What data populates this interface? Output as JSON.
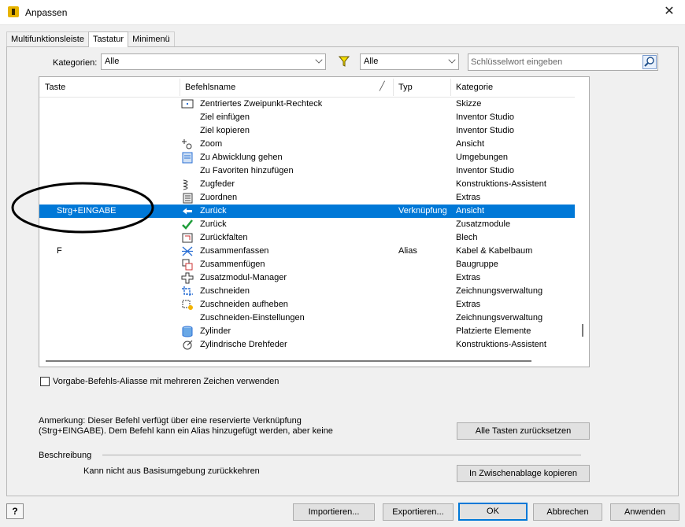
{
  "window": {
    "title": "Anpassen"
  },
  "tabs": [
    "Multifunktionsleiste",
    "Tastatur",
    "Minimenü"
  ],
  "filters": {
    "categories_label": "Kategorien:",
    "categories_value": "Alle",
    "filter_value": "Alle",
    "search_placeholder": "Schlüsselwort eingeben"
  },
  "columns": {
    "key": "Taste",
    "command": "Befehlsname",
    "type": "Typ",
    "category": "Kategorie"
  },
  "rows": [
    {
      "key": "",
      "command": "Zentriertes Zweipunkt-Rechteck",
      "type": "",
      "category": "Skizze",
      "icon": "rectangle-center-icon"
    },
    {
      "key": "",
      "command": "Ziel einfügen",
      "type": "",
      "category": "Inventor Studio",
      "icon": ""
    },
    {
      "key": "",
      "command": "Ziel kopieren",
      "type": "",
      "category": "Inventor Studio",
      "icon": ""
    },
    {
      "key": "",
      "command": "Zoom",
      "type": "",
      "category": "Ansicht",
      "icon": "zoom-icon"
    },
    {
      "key": "",
      "command": "Zu Abwicklung gehen",
      "type": "",
      "category": "Umgebungen",
      "icon": "flat-pattern-icon"
    },
    {
      "key": "",
      "command": "Zu Favoriten hinzufügen",
      "type": "",
      "category": "Inventor Studio",
      "icon": ""
    },
    {
      "key": "",
      "command": "Zugfeder",
      "type": "",
      "category": "Konstruktions-Assistent",
      "icon": "extension-spring-icon"
    },
    {
      "key": "",
      "command": "Zuordnen",
      "type": "",
      "category": "Extras",
      "icon": "assign-icon"
    },
    {
      "key": "Strg+EINGABE",
      "command": "Zurück",
      "type": "Verknüpfung",
      "category": "Ansicht",
      "icon": "back-arrow-icon"
    },
    {
      "key": "",
      "command": "Zurück",
      "type": "",
      "category": "Zusatzmodule",
      "icon": "checkmark-icon"
    },
    {
      "key": "",
      "command": "Zurückfalten",
      "type": "",
      "category": "Blech",
      "icon": "refold-icon"
    },
    {
      "key": "F",
      "command": "Zusammenfassen",
      "type": "Alias",
      "category": "Kabel & Kabelbaum",
      "icon": "merge-icon"
    },
    {
      "key": "",
      "command": "Zusammenfügen",
      "type": "",
      "category": "Baugruppe",
      "icon": "join-icon"
    },
    {
      "key": "",
      "command": "Zusatzmodul-Manager",
      "type": "",
      "category": "Extras",
      "icon": "addin-manager-icon"
    },
    {
      "key": "",
      "command": "Zuschneiden",
      "type": "",
      "category": "Zeichnungsverwaltung",
      "icon": "crop-icon"
    },
    {
      "key": "",
      "command": "Zuschneiden aufheben",
      "type": "",
      "category": "Extras",
      "icon": "uncrop-icon"
    },
    {
      "key": "",
      "command": "Zuschneiden-Einstellungen",
      "type": "",
      "category": "Zeichnungsverwaltung",
      "icon": ""
    },
    {
      "key": "",
      "command": "Zylinder",
      "type": "",
      "category": "Platzierte Elemente",
      "icon": "cylinder-icon"
    },
    {
      "key": "",
      "command": "Zylindrische Drehfeder",
      "type": "",
      "category": "Konstruktions-Assistent",
      "icon": "torsion-spring-icon"
    }
  ],
  "checkbox_label": "Vorgabe-Befehls-Aliasse mit mehreren Zeichen verwenden",
  "note": "Anmerkung: Dieser Befehl verfügt über eine reservierte Verknüpfung (Strg+EINGABE). Dem Befehl kann ein Alias hinzugefügt werden, aber keine",
  "description": {
    "label": "Beschreibung",
    "text": "Kann nicht aus Basisumgebung zurückkehren"
  },
  "buttons": {
    "reset_keys": "Alle Tasten zurücksetzen",
    "copy_clipboard": "In Zwischenablage kopieren",
    "import": "Importieren...",
    "export": "Exportieren...",
    "ok": "OK",
    "cancel": "Abbrechen",
    "apply": "Anwenden",
    "help": "?"
  },
  "colors": {
    "selection": "#0078d7",
    "annotation": "#000000"
  }
}
